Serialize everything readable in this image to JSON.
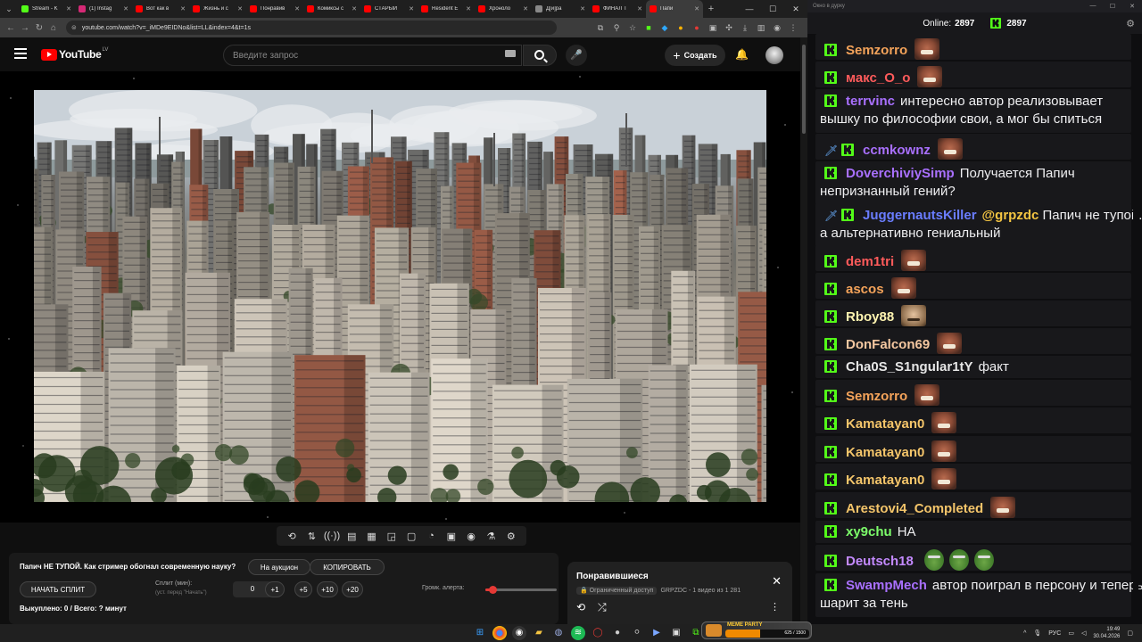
{
  "browser": {
    "tabs": [
      {
        "label": "Stream - K",
        "color": "#53fc18"
      },
      {
        "label": "(1) Instag",
        "color": "#d62976"
      },
      {
        "label": "Вот как в",
        "color": "#ff0000"
      },
      {
        "label": "Жизнь и с",
        "color": "#ff0000"
      },
      {
        "label": "Понравив",
        "color": "#ff0000"
      },
      {
        "label": "Комиксы с",
        "color": "#ff0000"
      },
      {
        "label": "СТАРЫЙ ",
        "color": "#ff0000"
      },
      {
        "label": "Resident E",
        "color": "#ff0000"
      },
      {
        "label": "Хроноло",
        "color": "#ff0000"
      },
      {
        "label": "Д[и]ра",
        "color": "#888888"
      },
      {
        "label": "ФИНАЛ Т",
        "color": "#ff0000"
      },
      {
        "label": "Папи",
        "color": "#ff0000"
      }
    ],
    "url": "youtube.com/watch?v=_iMDe9EIDNo&list=LL&index=4&t=1s"
  },
  "youtube": {
    "region": "LV",
    "logo_text": "YouTube",
    "search_placeholder": "Введите запрос",
    "create_label": "Создать"
  },
  "extension": {
    "title": "Папич НЕ ТУПОЙ. Как стример обогнал современную науку?",
    "auction_label": "На аукцион",
    "copy_label": "КОПИРОВАТЬ",
    "start_split_label": "НАЧАТЬ СПЛИТ",
    "split_label": "Сплит (мин):",
    "split_hint": "(уст. перед \"Начать\")",
    "split_value": "0",
    "increments": [
      "+1",
      "+5",
      "+10",
      "+20"
    ],
    "alert_volume_label": "Громк. алерта:",
    "alert_volume_fraction": 0.1,
    "status": "Выкуплено: 0 / Всего: ? минут"
  },
  "playlist": {
    "title": "Понравившиеся",
    "badge": "Ограниченный доступ",
    "meta": "GRPZDC - 1 видео из 1 281"
  },
  "chat": {
    "window_title": "Окно в дурку",
    "online_label": "Online:",
    "online_value": "2897",
    "k_value": "2897",
    "brand_color": "#53fc18",
    "messages": [
      {
        "nick": "Semzorro",
        "color": "#f4a35a",
        "text": "",
        "emote": "face"
      },
      {
        "nick": "макс_О_о",
        "color": "#ff5b5b",
        "text": "",
        "emote": "face"
      },
      {
        "nick": "terrvinc",
        "color": "#a970ff",
        "text": "интересно автор реализовывает",
        "text2": "вышку по философии свои, а мог бы спиться"
      },
      {
        "nick": "ccmkownz",
        "color": "#a970ff",
        "text": "",
        "emote": "face",
        "sword": true
      },
      {
        "nick": "DoverchiviySimp",
        "color": "#a970ff",
        "text": "Получается Папич",
        "text2": "непризнанный гений?"
      },
      {
        "nick": "JuggernautsKiller",
        "color": "#6a7dff",
        "text": "Папич не тупой.",
        "mention": "@grpzdc",
        "text2": "а альтернативно гениальный",
        "sword": true
      },
      {
        "nick": "dem1tri",
        "color": "#ff5b5b",
        "text": "",
        "emote": "face"
      },
      {
        "nick": "ascos",
        "color": "#f4a35a",
        "text": "",
        "emote": "face"
      },
      {
        "nick": "Rboy88",
        "color": "#fff4b0",
        "text": "",
        "emote": "wojak"
      },
      {
        "nick": "DonFalcon69",
        "color": "#f4c7a0",
        "text": "",
        "emote": "face"
      },
      {
        "nick": "Cha0S_S1ngular1tY",
        "color": "#e6e6e6",
        "text": "факт"
      },
      {
        "nick": "Semzorro",
        "color": "#f4a35a",
        "text": "",
        "emote": "face"
      },
      {
        "nick": "Kamatayan0",
        "color": "#f4c56a",
        "text": "",
        "emote": "face"
      },
      {
        "nick": "Kamatayan0",
        "color": "#f4c56a",
        "text": "",
        "emote": "face"
      },
      {
        "nick": "Kamatayan0",
        "color": "#f4c56a",
        "text": "",
        "emote": "face"
      },
      {
        "nick": "Arestovi4_Completed",
        "color": "#f4c56a",
        "text": "",
        "emote": "face"
      },
      {
        "nick": "xy9chu",
        "color": "#7cfc6a",
        "text": "НА"
      },
      {
        "nick": "Deutsch18",
        "color": "#c48aff",
        "text": "",
        "emote": "pepe3"
      },
      {
        "nick": "SwampMech",
        "color": "#a970ff",
        "text": "автор поиграл в персону и теперь",
        "text2": "шарит за тень"
      }
    ]
  },
  "taskbar": {
    "meme_party_label": "MEME PARTY",
    "meme_party_progress_text": "625 / 1500",
    "meme_party_fraction": 0.42,
    "lang": "РУС",
    "time": "19:49",
    "date": "30.04.2026"
  }
}
